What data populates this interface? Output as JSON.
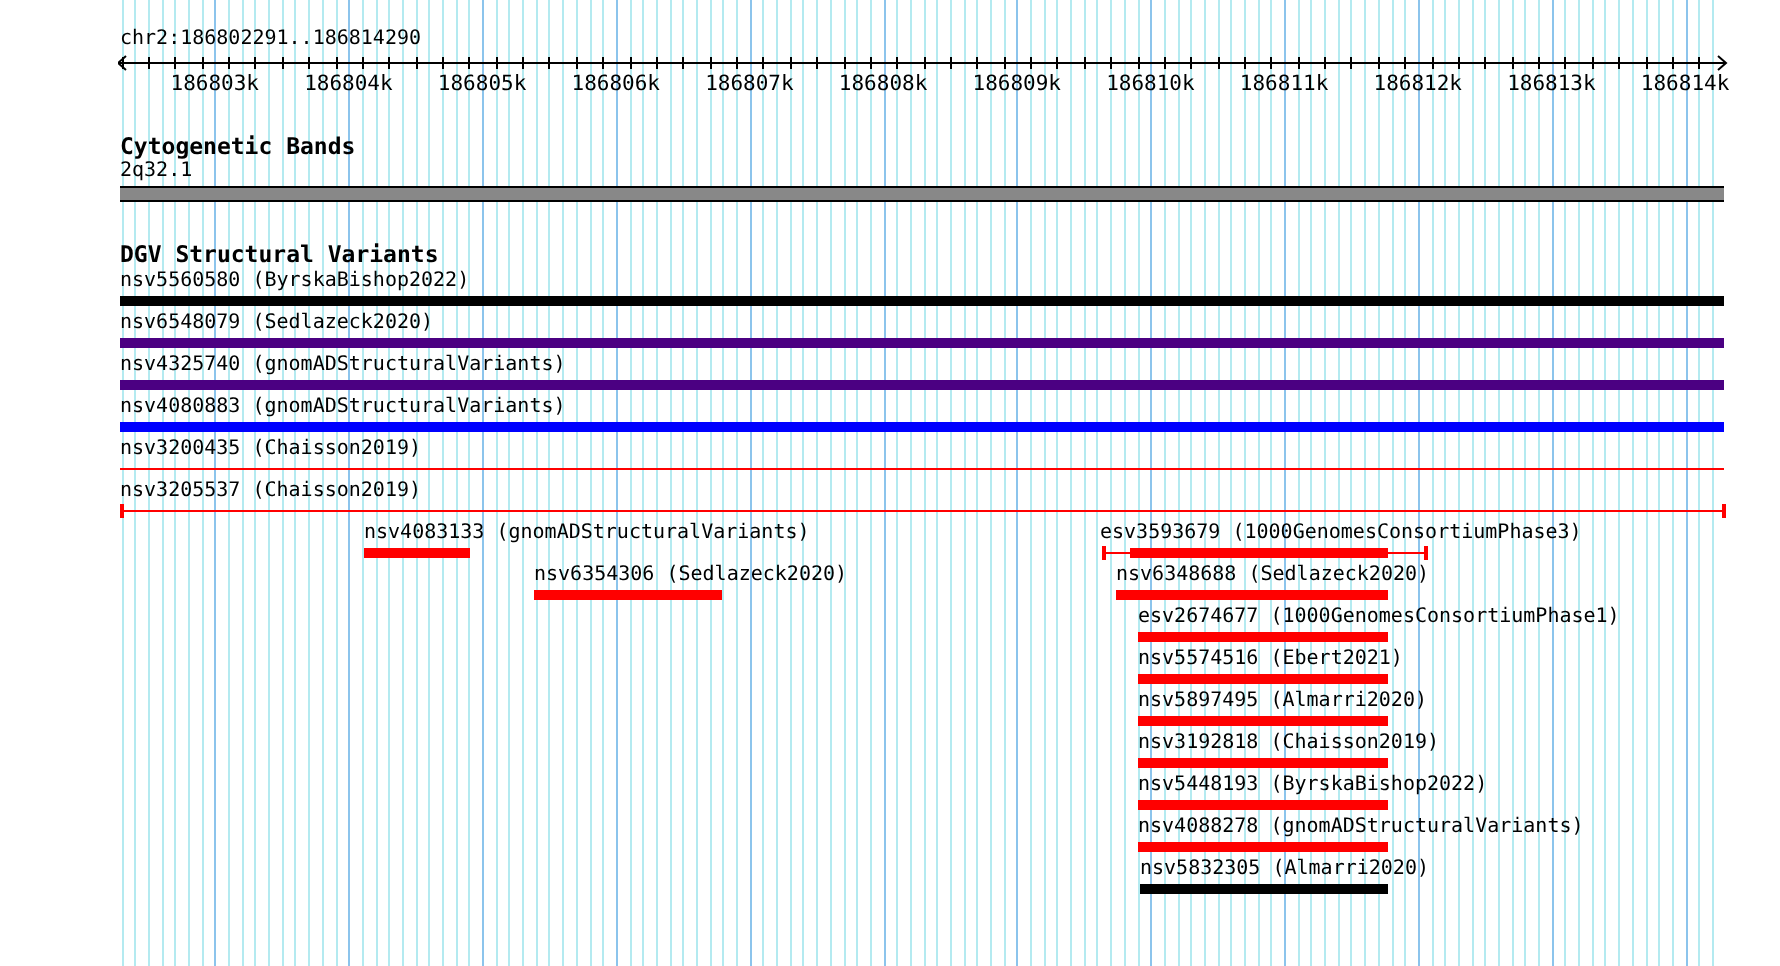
{
  "ruler": {
    "location": "chr2:186802291..186814290",
    "tick_labels": [
      "186803k",
      "186804k",
      "186805k",
      "186806k",
      "186807k",
      "186808k",
      "186809k",
      "186810k",
      "186811k",
      "186812k",
      "186813k",
      "186814k"
    ]
  },
  "cytogenetic_bands": {
    "title": "Cytogenetic Bands",
    "band": "2q32.1"
  },
  "dgv_structural_variants": {
    "title": "DGV Structural Variants",
    "variants": [
      {
        "label": "nsv5560580 (ByrskaBishop2022)",
        "kind": "bar",
        "color": "#000000"
      },
      {
        "label": "nsv6548079 (Sedlazeck2020)",
        "kind": "bar",
        "color": "#4b0082"
      },
      {
        "label": "nsv4325740 (gnomADStructuralVariants)",
        "kind": "bar",
        "color": "#4b0082"
      },
      {
        "label": "nsv4080883 (gnomADStructuralVariants)",
        "kind": "bar",
        "color": "#0000ff"
      },
      {
        "label": "nsv3200435 (Chaisson2019)",
        "kind": "line",
        "color": "#ff0000"
      },
      {
        "label": "nsv3205537 (Chaisson2019)",
        "kind": "capped_line",
        "color": "#ff0000"
      },
      {
        "label": "nsv4083133 (gnomADStructuralVariants)",
        "kind": "bar",
        "color": "#ff0000"
      },
      {
        "label": "esv3593679 (1000GenomesConsortiumPhase3)",
        "kind": "capped_bar",
        "color": "#ff0000"
      },
      {
        "label": "nsv6354306 (Sedlazeck2020)",
        "kind": "bar",
        "color": "#ff0000"
      },
      {
        "label": "nsv6348688 (Sedlazeck2020)",
        "kind": "bar",
        "color": "#ff0000"
      },
      {
        "label": "esv2674677 (1000GenomesConsortiumPhase1)",
        "kind": "bar",
        "color": "#ff0000"
      },
      {
        "label": "nsv5574516 (Ebert2021)",
        "kind": "bar",
        "color": "#ff0000"
      },
      {
        "label": "nsv5897495 (Almarri2020)",
        "kind": "bar",
        "color": "#ff0000"
      },
      {
        "label": "nsv3192818 (Chaisson2019)",
        "kind": "bar",
        "color": "#ff0000"
      },
      {
        "label": "nsv5448193 (ByrskaBishop2022)",
        "kind": "bar",
        "color": "#ff0000"
      },
      {
        "label": "nsv4088278 (gnomADStructuralVariants)",
        "kind": "bar",
        "color": "#ff0000"
      },
      {
        "label": "nsv5832305 (Almarri2020)",
        "kind": "bar",
        "color": "#000000"
      }
    ]
  }
}
